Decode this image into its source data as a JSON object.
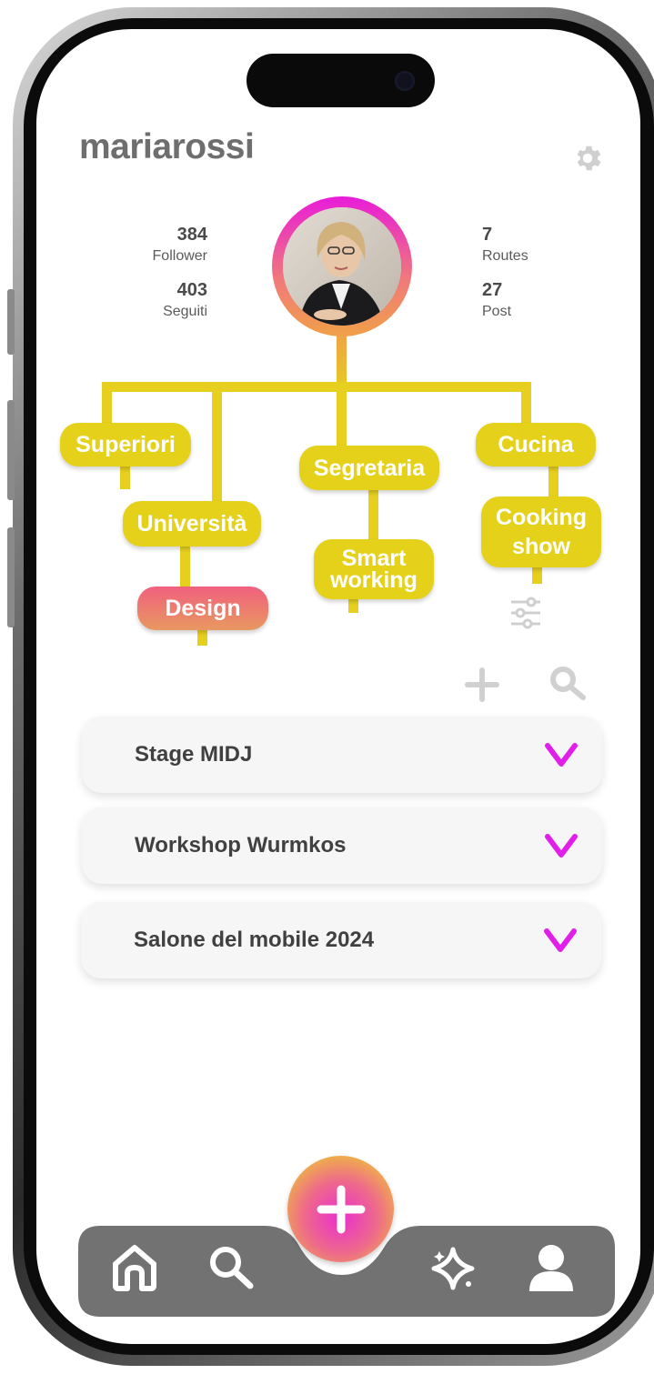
{
  "profile": {
    "username": "mariarossi",
    "stats_left": [
      {
        "value": "384",
        "label": "Follower"
      },
      {
        "value": "403",
        "label": "Seguiti"
      }
    ],
    "stats_right": [
      {
        "value": "7",
        "label": "Routes"
      },
      {
        "value": "27",
        "label": "Post"
      }
    ]
  },
  "tree": {
    "nodes": {
      "superiori": "Superiori",
      "universita": "Università",
      "design": "Design",
      "segretaria": "Segretaria",
      "smart_working_1": "Smart",
      "smart_working_2": "working",
      "cucina": "Cucina",
      "cooking_show_1": "Cooking",
      "cooking_show_2": "show"
    },
    "active_node": "Design"
  },
  "events": [
    {
      "title": "Stage MIDJ"
    },
    {
      "title": "Workshop Wurmkos"
    },
    {
      "title": "Salone del mobile 2024"
    }
  ],
  "nav": {
    "items": [
      "home-icon",
      "search-icon",
      "sparkle-icon",
      "profile-icon"
    ],
    "fab_icon": "plus-icon"
  },
  "colors": {
    "accent_yellow": "#e5d11a",
    "accent_magenta": "#e81cd9",
    "nav_gray": "#727272"
  }
}
